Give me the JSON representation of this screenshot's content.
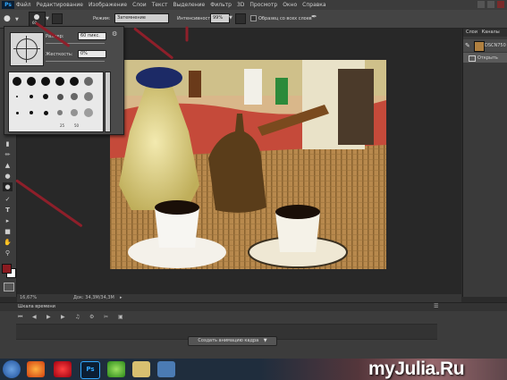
{
  "app": {
    "logo": "Ps"
  },
  "menu": [
    "Файл",
    "Редактирование",
    "Изображение",
    "Слои",
    "Текст",
    "Выделение",
    "Фильтр",
    "3D",
    "Просмотр",
    "Окно",
    "Справка"
  ],
  "options": {
    "brush_size": "60",
    "mode_label": "Режим:",
    "mode_value": "Затемнение",
    "intensity_label": "Интенсивность:",
    "intensity_value": "99%",
    "sample_all_layers": "Образец со всех слоев"
  },
  "brush_popup": {
    "size_label": "Размер:",
    "size_value": "60 пикс.",
    "hardness_label": "Жесткость:",
    "hardness_value": "0%",
    "preset_numbers": [
      "25",
      "50"
    ]
  },
  "status": {
    "zoom": "16,67%",
    "doc": "Док: 34,3M/34,3M"
  },
  "timeline": {
    "title": "Шкала времени",
    "create_button": "Создать анимацию кадра"
  },
  "right_panel": {
    "tabs": [
      "Слои",
      "Каналы"
    ],
    "layer_name": "DSCN750",
    "open_label": "Открыть"
  },
  "watermark": {
    "text": "myJulia.Ru",
    "accent": "#e0b020"
  },
  "colors": {
    "arrow": "#8e1f2a",
    "foreground": "#8b1b20",
    "background": "#ffffff"
  }
}
